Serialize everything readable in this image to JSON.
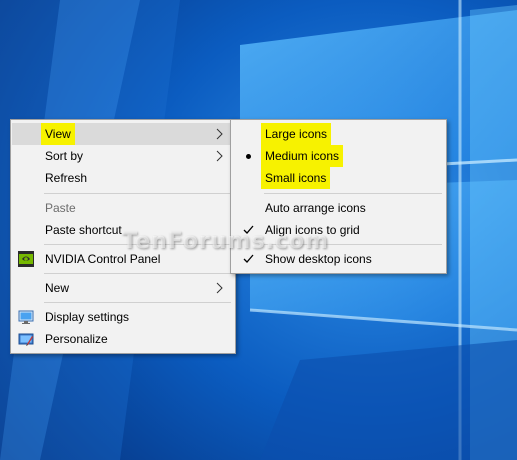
{
  "desktop": {
    "wallpaper": "windows-10-hero",
    "colors": {
      "dark": "#063c8c",
      "light": "#3fa9ff"
    }
  },
  "context_menu": {
    "items": [
      {
        "label": "View",
        "highlighted": true,
        "submenu": true
      },
      {
        "label": "Sort by",
        "submenu": true
      },
      {
        "label": "Refresh"
      },
      {
        "label": "Paste",
        "disabled": true
      },
      {
        "label": "Paste shortcut"
      },
      {
        "label": "NVIDIA Control Panel",
        "icon": "nvidia-icon"
      },
      {
        "label": "New",
        "submenu": true
      },
      {
        "label": "Display settings",
        "icon": "display-icon"
      },
      {
        "label": "Personalize",
        "icon": "personalize-icon"
      }
    ]
  },
  "view_submenu": {
    "items": [
      {
        "label": "Large icons"
      },
      {
        "label": "Medium icons",
        "selected": true
      },
      {
        "label": "Small icons"
      },
      {
        "label": "Auto arrange icons"
      },
      {
        "label": "Align icons to grid",
        "checked": true
      },
      {
        "label": "Show desktop icons",
        "checked": true
      }
    ],
    "highlight_color": "#f7f200"
  },
  "watermark": "TenForums.com"
}
